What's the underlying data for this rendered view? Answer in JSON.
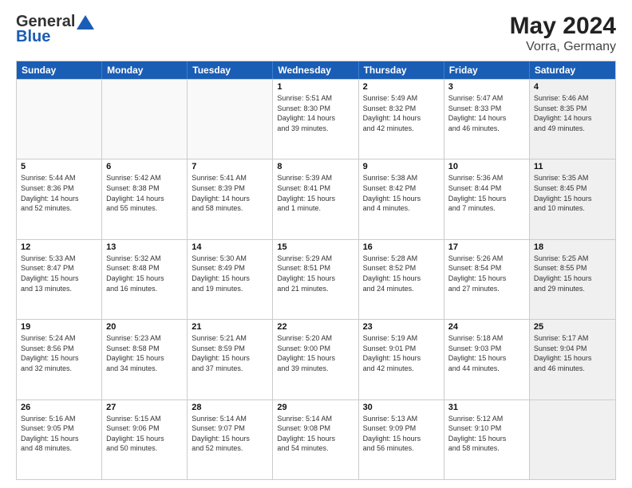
{
  "logo": {
    "general": "General",
    "blue": "Blue"
  },
  "title": "May 2024",
  "subtitle": "Vorra, Germany",
  "headers": [
    "Sunday",
    "Monday",
    "Tuesday",
    "Wednesday",
    "Thursday",
    "Friday",
    "Saturday"
  ],
  "weeks": [
    [
      {
        "day": "",
        "text": "",
        "empty": true
      },
      {
        "day": "",
        "text": "",
        "empty": true
      },
      {
        "day": "",
        "text": "",
        "empty": true
      },
      {
        "day": "1",
        "text": "Sunrise: 5:51 AM\nSunset: 8:30 PM\nDaylight: 14 hours\nand 39 minutes."
      },
      {
        "day": "2",
        "text": "Sunrise: 5:49 AM\nSunset: 8:32 PM\nDaylight: 14 hours\nand 42 minutes."
      },
      {
        "day": "3",
        "text": "Sunrise: 5:47 AM\nSunset: 8:33 PM\nDaylight: 14 hours\nand 46 minutes."
      },
      {
        "day": "4",
        "text": "Sunrise: 5:46 AM\nSunset: 8:35 PM\nDaylight: 14 hours\nand 49 minutes.",
        "shaded": true
      }
    ],
    [
      {
        "day": "5",
        "text": "Sunrise: 5:44 AM\nSunset: 8:36 PM\nDaylight: 14 hours\nand 52 minutes."
      },
      {
        "day": "6",
        "text": "Sunrise: 5:42 AM\nSunset: 8:38 PM\nDaylight: 14 hours\nand 55 minutes."
      },
      {
        "day": "7",
        "text": "Sunrise: 5:41 AM\nSunset: 8:39 PM\nDaylight: 14 hours\nand 58 minutes."
      },
      {
        "day": "8",
        "text": "Sunrise: 5:39 AM\nSunset: 8:41 PM\nDaylight: 15 hours\nand 1 minute."
      },
      {
        "day": "9",
        "text": "Sunrise: 5:38 AM\nSunset: 8:42 PM\nDaylight: 15 hours\nand 4 minutes."
      },
      {
        "day": "10",
        "text": "Sunrise: 5:36 AM\nSunset: 8:44 PM\nDaylight: 15 hours\nand 7 minutes."
      },
      {
        "day": "11",
        "text": "Sunrise: 5:35 AM\nSunset: 8:45 PM\nDaylight: 15 hours\nand 10 minutes.",
        "shaded": true
      }
    ],
    [
      {
        "day": "12",
        "text": "Sunrise: 5:33 AM\nSunset: 8:47 PM\nDaylight: 15 hours\nand 13 minutes."
      },
      {
        "day": "13",
        "text": "Sunrise: 5:32 AM\nSunset: 8:48 PM\nDaylight: 15 hours\nand 16 minutes."
      },
      {
        "day": "14",
        "text": "Sunrise: 5:30 AM\nSunset: 8:49 PM\nDaylight: 15 hours\nand 19 minutes."
      },
      {
        "day": "15",
        "text": "Sunrise: 5:29 AM\nSunset: 8:51 PM\nDaylight: 15 hours\nand 21 minutes."
      },
      {
        "day": "16",
        "text": "Sunrise: 5:28 AM\nSunset: 8:52 PM\nDaylight: 15 hours\nand 24 minutes."
      },
      {
        "day": "17",
        "text": "Sunrise: 5:26 AM\nSunset: 8:54 PM\nDaylight: 15 hours\nand 27 minutes."
      },
      {
        "day": "18",
        "text": "Sunrise: 5:25 AM\nSunset: 8:55 PM\nDaylight: 15 hours\nand 29 minutes.",
        "shaded": true
      }
    ],
    [
      {
        "day": "19",
        "text": "Sunrise: 5:24 AM\nSunset: 8:56 PM\nDaylight: 15 hours\nand 32 minutes."
      },
      {
        "day": "20",
        "text": "Sunrise: 5:23 AM\nSunset: 8:58 PM\nDaylight: 15 hours\nand 34 minutes."
      },
      {
        "day": "21",
        "text": "Sunrise: 5:21 AM\nSunset: 8:59 PM\nDaylight: 15 hours\nand 37 minutes."
      },
      {
        "day": "22",
        "text": "Sunrise: 5:20 AM\nSunset: 9:00 PM\nDaylight: 15 hours\nand 39 minutes."
      },
      {
        "day": "23",
        "text": "Sunrise: 5:19 AM\nSunset: 9:01 PM\nDaylight: 15 hours\nand 42 minutes."
      },
      {
        "day": "24",
        "text": "Sunrise: 5:18 AM\nSunset: 9:03 PM\nDaylight: 15 hours\nand 44 minutes."
      },
      {
        "day": "25",
        "text": "Sunrise: 5:17 AM\nSunset: 9:04 PM\nDaylight: 15 hours\nand 46 minutes.",
        "shaded": true
      }
    ],
    [
      {
        "day": "26",
        "text": "Sunrise: 5:16 AM\nSunset: 9:05 PM\nDaylight: 15 hours\nand 48 minutes."
      },
      {
        "day": "27",
        "text": "Sunrise: 5:15 AM\nSunset: 9:06 PM\nDaylight: 15 hours\nand 50 minutes."
      },
      {
        "day": "28",
        "text": "Sunrise: 5:14 AM\nSunset: 9:07 PM\nDaylight: 15 hours\nand 52 minutes."
      },
      {
        "day": "29",
        "text": "Sunrise: 5:14 AM\nSunset: 9:08 PM\nDaylight: 15 hours\nand 54 minutes."
      },
      {
        "day": "30",
        "text": "Sunrise: 5:13 AM\nSunset: 9:09 PM\nDaylight: 15 hours\nand 56 minutes."
      },
      {
        "day": "31",
        "text": "Sunrise: 5:12 AM\nSunset: 9:10 PM\nDaylight: 15 hours\nand 58 minutes."
      },
      {
        "day": "",
        "text": "",
        "empty": true,
        "shaded": true
      }
    ]
  ]
}
